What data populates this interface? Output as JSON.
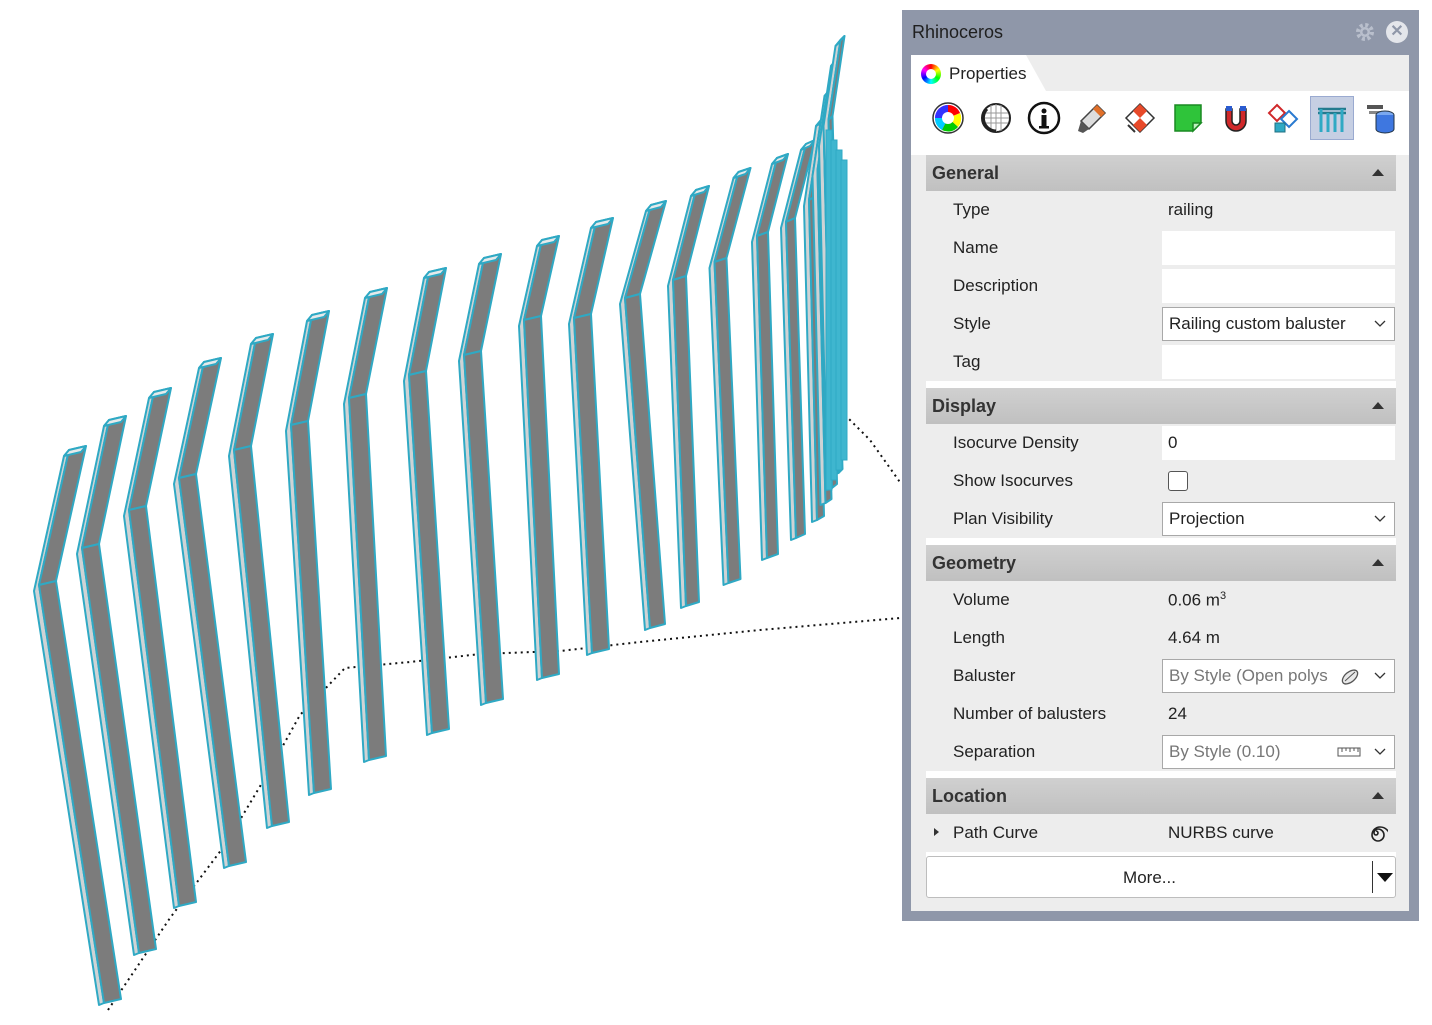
{
  "window": {
    "title": "Rhinoceros"
  },
  "tab": {
    "label": "Properties"
  },
  "toolbar": {
    "icons": [
      "material-color-wheel-icon",
      "render-mesh-icon",
      "object-info-icon",
      "paint-brush-icon",
      "texture-mapping-icon",
      "decal-icon",
      "attached-data-icon",
      "linked-blocks-icon",
      "railing-icon",
      "database-icon"
    ],
    "active": "railing-icon"
  },
  "sections": {
    "general": {
      "title": "General",
      "type_label": "Type",
      "type_value": "railing",
      "name_label": "Name",
      "name_value": "",
      "description_label": "Description",
      "description_value": "",
      "style_label": "Style",
      "style_value": "Railing custom baluster",
      "tag_label": "Tag",
      "tag_value": ""
    },
    "display": {
      "title": "Display",
      "isocurve_density_label": "Isocurve Density",
      "isocurve_density_value": "0",
      "show_isocurves_label": "Show Isocurves",
      "show_isocurves_checked": false,
      "plan_visibility_label": "Plan Visibility",
      "plan_visibility_value": "Projection"
    },
    "geometry": {
      "title": "Geometry",
      "volume_label": "Volume",
      "volume_value": "0.06 m",
      "volume_unit_exp": "3",
      "length_label": "Length",
      "length_value": "4.64 m",
      "baluster_label": "Baluster",
      "baluster_value": "By Style (Open polys",
      "balusters_count_label": "Number of balusters",
      "balusters_count_value": "24",
      "separation_label": "Separation",
      "separation_value": "By Style (0.10)"
    },
    "location": {
      "title": "Location",
      "path_curve_label": "Path Curve",
      "path_curve_value": "NURBS curve"
    }
  },
  "more_button": {
    "label": "More..."
  },
  "viewport": {
    "baluster_count": 24,
    "selection_color": "#2fa9c4",
    "face_color": "#7c7c7c"
  }
}
